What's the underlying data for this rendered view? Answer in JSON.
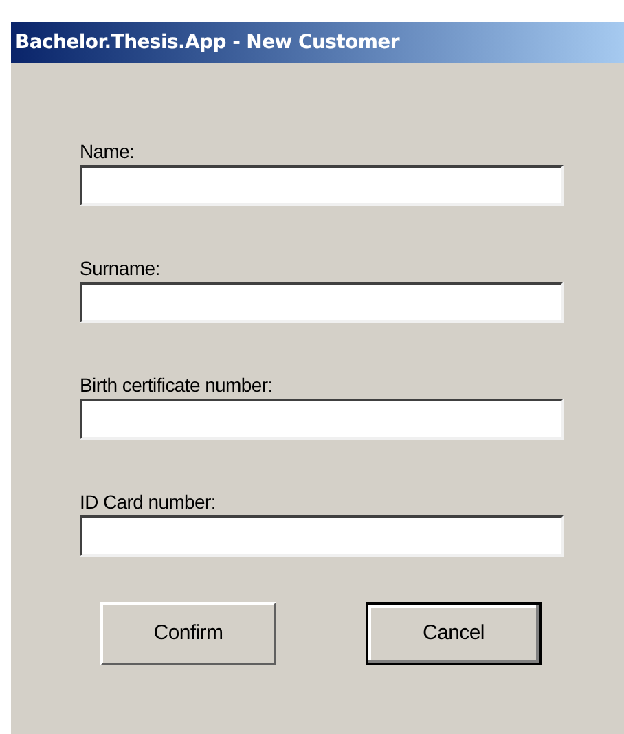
{
  "window": {
    "title": "Bachelor.Thesis.App - New Customer"
  },
  "fields": [
    {
      "label": "Name:"
    },
    {
      "label": "Surname:"
    },
    {
      "label": "Birth certificate number:"
    },
    {
      "label": "ID Card number:"
    }
  ],
  "buttons": [
    {
      "label": "Confirm",
      "default": false
    },
    {
      "label": "Cancel",
      "default": true
    }
  ]
}
